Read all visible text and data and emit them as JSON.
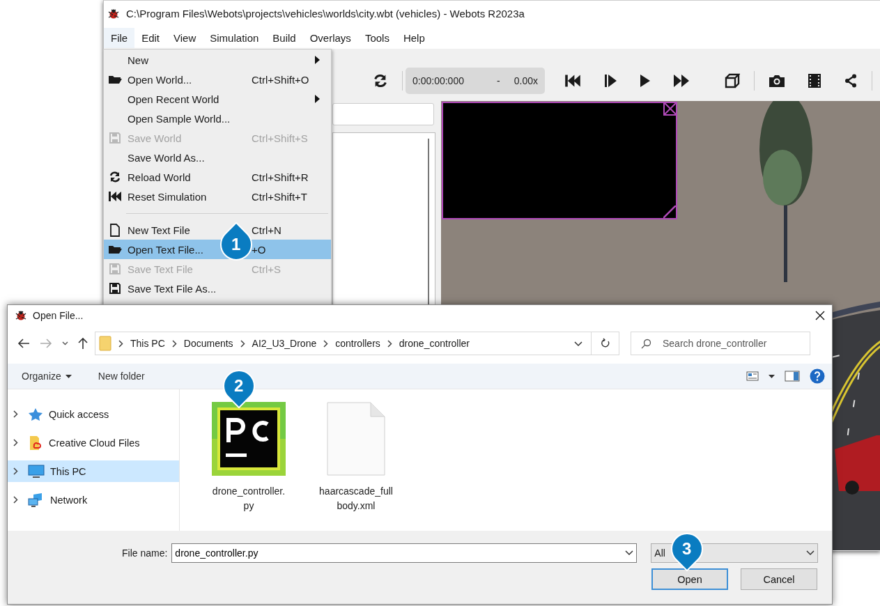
{
  "main_window": {
    "title": "C:\\Program Files\\Webots\\projects\\vehicles\\worlds\\city.wbt (vehicles) - Webots R2023a",
    "menubar": [
      {
        "label": "File",
        "selected": true
      },
      {
        "label": "Edit",
        "selected": false
      },
      {
        "label": "View",
        "selected": false
      },
      {
        "label": "Simulation",
        "selected": false
      },
      {
        "label": "Build",
        "selected": false
      },
      {
        "label": "Overlays",
        "selected": false
      },
      {
        "label": "Tools",
        "selected": false
      },
      {
        "label": "Help",
        "selected": false
      }
    ],
    "toolbar": {
      "time": "0:00:00:000",
      "separator": "-",
      "speed": "0.00x"
    }
  },
  "file_menu": [
    {
      "kind": "item",
      "label": "New",
      "submenu": true,
      "disabled": false,
      "selected": false
    },
    {
      "kind": "item",
      "label": "Open World...",
      "shortcut": "Ctrl+Shift+O",
      "submenu": false,
      "disabled": false,
      "selected": false
    },
    {
      "kind": "item",
      "label": "Open Recent World",
      "submenu": true,
      "disabled": false,
      "selected": false
    },
    {
      "kind": "item",
      "label": "Open Sample World...",
      "submenu": false,
      "disabled": false,
      "selected": false
    },
    {
      "kind": "item",
      "label": "Save World",
      "shortcut": "Ctrl+Shift+S",
      "submenu": false,
      "disabled": true,
      "selected": false
    },
    {
      "kind": "item",
      "label": "Save World As...",
      "submenu": false,
      "disabled": false,
      "selected": false
    },
    {
      "kind": "item",
      "label": "Reload World",
      "shortcut": "Ctrl+Shift+R",
      "submenu": false,
      "disabled": false,
      "selected": false
    },
    {
      "kind": "item",
      "label": "Reset Simulation",
      "shortcut": "Ctrl+Shift+T",
      "submenu": false,
      "disabled": false,
      "selected": false
    },
    {
      "kind": "separator"
    },
    {
      "kind": "item",
      "label": "New Text File",
      "shortcut": "Ctrl+N",
      "submenu": false,
      "disabled": false,
      "selected": false
    },
    {
      "kind": "item",
      "label": "Open Text File...",
      "shortcut": "+O",
      "submenu": false,
      "disabled": false,
      "selected": true
    },
    {
      "kind": "item",
      "label": "Save Text File",
      "shortcut": "Ctrl+S",
      "submenu": false,
      "disabled": true,
      "selected": false
    },
    {
      "kind": "item",
      "label": "Save Text File As...",
      "submenu": false,
      "disabled": false,
      "selected": false
    }
  ],
  "dialog": {
    "title": "Open File...",
    "path": [
      "This PC",
      "Documents",
      "AI2_U3_Drone",
      "controllers",
      "drone_controller"
    ],
    "search": {
      "placeholder": "Search drone_controller"
    },
    "commands": [
      {
        "label": "Organize",
        "dropdown": true
      },
      {
        "label": "New folder",
        "dropdown": false
      }
    ],
    "nav": [
      {
        "label": "Quick access",
        "selected": false
      },
      {
        "label": "Creative Cloud Files",
        "selected": false
      },
      {
        "label": "This PC",
        "selected": true
      },
      {
        "label": "Network",
        "selected": false
      }
    ],
    "files": [
      {
        "name": "drone_controller.py",
        "kind": "app"
      },
      {
        "name": "haarcascade_fullbody.xml",
        "kind": "document"
      }
    ],
    "file_name_label": "File name:",
    "file_name": "drone_controller.py",
    "filter": "All",
    "buttons": [
      {
        "label": "Open",
        "selected": true
      },
      {
        "label": "Cancel",
        "selected": false
      }
    ]
  },
  "callouts": [
    {
      "label": "1"
    },
    {
      "label": "2"
    },
    {
      "label": "3"
    }
  ]
}
